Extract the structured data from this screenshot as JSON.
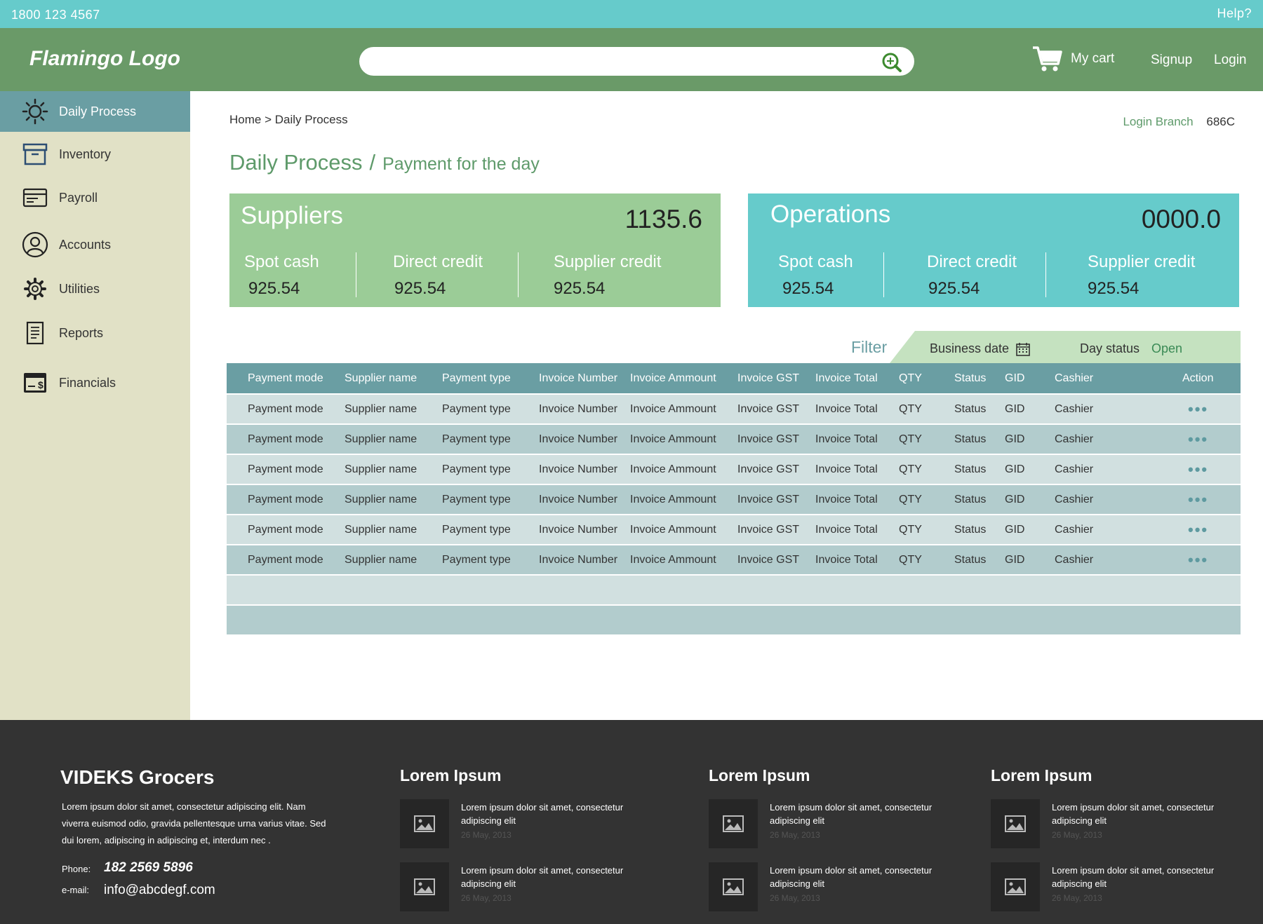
{
  "topbar": {
    "phone": "1800 123 4567",
    "help": "Help?"
  },
  "header": {
    "logo": "Flamingo Logo",
    "search_placeholder": "",
    "cart_label": "My cart",
    "signup": "Signup",
    "login": "Login"
  },
  "sidebar": {
    "items": [
      {
        "label": "Daily Process",
        "icon": "sun-icon"
      },
      {
        "label": "Inventory",
        "icon": "archive-box-icon"
      },
      {
        "label": "Payroll",
        "icon": "card-icon"
      },
      {
        "label": "Accounts",
        "icon": "user-icon"
      },
      {
        "label": "Utilities",
        "icon": "gear-icon"
      },
      {
        "label": "Reports",
        "icon": "document-icon"
      },
      {
        "label": "Financials",
        "icon": "money-card-icon"
      }
    ]
  },
  "main": {
    "breadcrumb": "Home > Daily Process",
    "branch_label": "Login Branch",
    "branch_value": "686C",
    "title": "Daily Process",
    "title_sep": "/",
    "subtitle": "Payment for the day",
    "cards": [
      {
        "title": "Suppliers",
        "total": "1135.6",
        "cols": [
          {
            "label": "Spot cash",
            "value": "925.54"
          },
          {
            "label": "Direct credit",
            "value": "925.54"
          },
          {
            "label": "Supplier credit",
            "value": "925.54"
          }
        ]
      },
      {
        "title": "Operations",
        "total": "0000.0",
        "cols": [
          {
            "label": "Spot cash",
            "value": "925.54"
          },
          {
            "label": "Direct credit",
            "value": "925.54"
          },
          {
            "label": "Supplier credit",
            "value": "925.54"
          }
        ]
      }
    ],
    "filter": {
      "label": "Filter",
      "business_date": "Business date",
      "day_status_label": "Day status",
      "day_status_value": "Open"
    },
    "table": {
      "headers": [
        "Payment mode",
        "Supplier name",
        "Payment type",
        "Invoice Number",
        "Invoice Ammount",
        "Invoice GST",
        "Invoice Total",
        "QTY",
        "Status",
        "GID",
        "Cashier",
        "Action"
      ],
      "rows": [
        [
          "Payment mode",
          "Supplier name",
          "Payment type",
          "Invoice Number",
          "Invoice Ammount",
          "Invoice GST",
          "Invoice Total",
          "QTY",
          "Status",
          "GID",
          "Cashier",
          "•••"
        ],
        [
          "Payment mode",
          "Supplier name",
          "Payment type",
          "Invoice Number",
          "Invoice Ammount",
          "Invoice GST",
          "Invoice Total",
          "QTY",
          "Status",
          "GID",
          "Cashier",
          "•••"
        ],
        [
          "Payment mode",
          "Supplier name",
          "Payment type",
          "Invoice Number",
          "Invoice Ammount",
          "Invoice GST",
          "Invoice Total",
          "QTY",
          "Status",
          "GID",
          "Cashier",
          "•••"
        ],
        [
          "Payment mode",
          "Supplier name",
          "Payment type",
          "Invoice Number",
          "Invoice Ammount",
          "Invoice GST",
          "Invoice Total",
          "QTY",
          "Status",
          "GID",
          "Cashier",
          "•••"
        ],
        [
          "Payment mode",
          "Supplier name",
          "Payment type",
          "Invoice Number",
          "Invoice Ammount",
          "Invoice GST",
          "Invoice Total",
          "QTY",
          "Status",
          "GID",
          "Cashier",
          "•••"
        ],
        [
          "Payment mode",
          "Supplier name",
          "Payment type",
          "Invoice Number",
          "Invoice Ammount",
          "Invoice GST",
          "Invoice Total",
          "QTY",
          "Status",
          "GID",
          "Cashier",
          "•••"
        ]
      ],
      "empty_rows": 2
    }
  },
  "footer": {
    "brand": "VIDEKS Grocers",
    "description": "Lorem ipsum dolor sit amet, consectetur adipiscing elit. Nam viverra euismod odio, gravida pellentesque urna varius vitae. Sed dui lorem, adipiscing in adipiscing et, interdum nec .",
    "phone_label": "Phone:",
    "phone": "182 2569 5896",
    "email_label": "e-mail:",
    "email": "info@abcdegf.com",
    "columns": [
      {
        "title": "Lorem Ipsum",
        "items": [
          {
            "text": "Lorem ipsum dolor sit amet, consectetur adipiscing elit",
            "date": "26 May, 2013"
          },
          {
            "text": "Lorem ipsum dolor sit amet, consectetur adipiscing elit",
            "date": "26 May, 2013"
          }
        ]
      },
      {
        "title": "Lorem Ipsum",
        "items": [
          {
            "text": "Lorem ipsum dolor sit amet, consectetur adipiscing elit",
            "date": "26 May, 2013"
          },
          {
            "text": "Lorem ipsum dolor sit amet, consectetur adipiscing elit",
            "date": "26 May, 2013"
          }
        ]
      },
      {
        "title": "Lorem Ipsum",
        "items": [
          {
            "text": "Lorem ipsum dolor sit amet, consectetur adipiscing elit",
            "date": "26 May, 2013"
          },
          {
            "text": "Lorem ipsum dolor sit amet, consectetur adipiscing elit",
            "date": "26 May, 2013"
          }
        ]
      }
    ]
  },
  "colors": {
    "topbar": "#66cbcb",
    "header": "#6a9a68",
    "sidebar": "#e1e1c6",
    "sidebar_active": "#6a9ea3",
    "suppliers_card": "#9bcc97",
    "operations_card": "#66cbcb",
    "table_header": "#6a9ea3",
    "row_light": "#d1e0e0",
    "row_dark": "#b2cccd",
    "footer": "#333333"
  }
}
